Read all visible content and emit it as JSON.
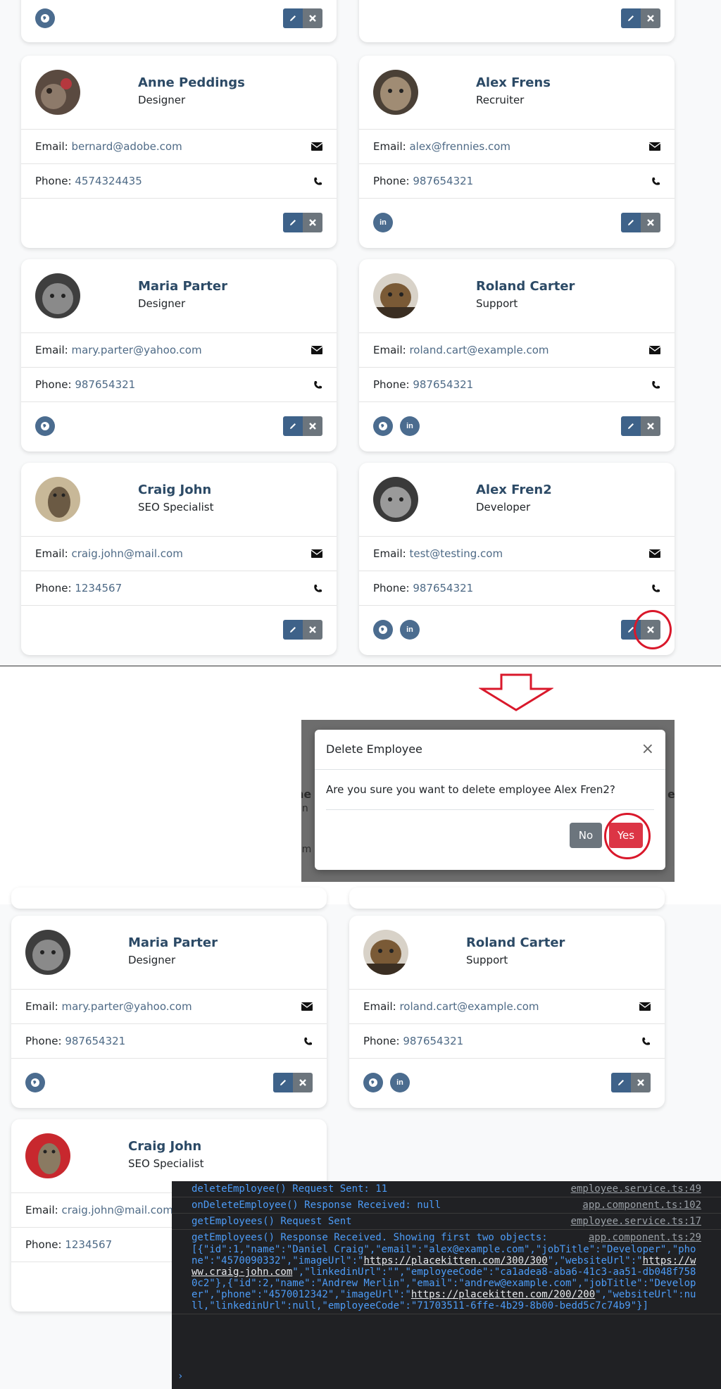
{
  "top_cards": [
    {
      "name": "Anne Peddings",
      "job": "Designer",
      "email": "bernard@adobe.com",
      "phone": "4574324435",
      "socials": []
    },
    {
      "name": "Alex Frens",
      "job": "Recruiter",
      "email": "alex@frennies.com",
      "phone": "987654321",
      "socials": [
        "linkedin"
      ]
    },
    {
      "name": "Maria Parter",
      "job": "Designer",
      "email": "mary.parter@yahoo.com",
      "phone": "987654321",
      "socials": [
        "globe"
      ]
    },
    {
      "name": "Roland Carter",
      "job": "Support",
      "email": "roland.cart@example.com",
      "phone": "987654321",
      "socials": [
        "globe",
        "linkedin"
      ]
    },
    {
      "name": "Craig John",
      "job": "SEO Specialist",
      "email": "craig.john@mail.com",
      "phone": "1234567",
      "socials": []
    },
    {
      "name": "Alex Fren2",
      "job": "Developer",
      "email": "test@testing.com",
      "phone": "987654321",
      "socials": [
        "globe",
        "linkedin"
      ]
    }
  ],
  "labels": {
    "email": "Email:",
    "phone": "Phone:"
  },
  "modal": {
    "title": "Delete Employee",
    "close": "×",
    "body": "Are you sure you want to delete employee Alex Fren2?",
    "no": "No",
    "yes": "Yes"
  },
  "bottom_cards": [
    {
      "name": "Maria Parter",
      "job": "Designer",
      "email": "mary.parter@yahoo.com",
      "phone": "987654321"
    },
    {
      "name": "Roland Carter",
      "job": "Support",
      "email": "roland.cart@example.com",
      "phone": "987654321"
    },
    {
      "name": "Craig John",
      "job": "SEO Specialist",
      "email": "craig.john@mail.com",
      "phone": "1234567"
    }
  ],
  "console": {
    "lines": [
      {
        "text": "deleteEmployee() Request Sent: 11",
        "source": "employee.service.ts:49"
      },
      {
        "text": "onDeleteEmployee() Response Received: null",
        "source": "app.component.ts:102"
      },
      {
        "text": "getEmployees() Request Sent",
        "source": "employee.service.ts:17"
      },
      {
        "text": "getEmployees() Response Received. Showing first two objects:",
        "source": "app.component.ts:29"
      }
    ],
    "object_parts": [
      "[{\"id\":1,\"name\":\"Daniel Craig\",\"email\":\"alex@example.com\",\"jobTitle\":\"Developer\",\"phone\":\"4570090332\",\"imageUrl\":\"",
      "https://placekitten.com/300/300",
      "\",\"websiteUrl\":\"",
      "https://www.craig-john.com",
      "\",\"linkedinUrl\":\"\",\"employeeCode\":\"ca1adea8-aba6-41c3-aa51-db048f7580c2\"},{\"id\":2,\"name\":\"Andrew Merlin\",\"email\":\"andrew@example.com\",\"jobTitle\":\"Developer\",\"phone\":\"4570012342\",\"imageUrl\":\"",
      "https://placekitten.com/200/200",
      "\",\"websiteUrl\":null,\"linkedinUrl\":null,\"employeeCode\":\"71703511-6ffe-4b29-8b00-bedd5c7c74b9\"}]"
    ],
    "prompt": "›"
  },
  "colors": {
    "name": "#2c4a66",
    "value": "#4e6a86",
    "edit": "#3e6289",
    "delete": "#6c757d",
    "yes": "#dc3545",
    "highlight": "#d9182b"
  }
}
